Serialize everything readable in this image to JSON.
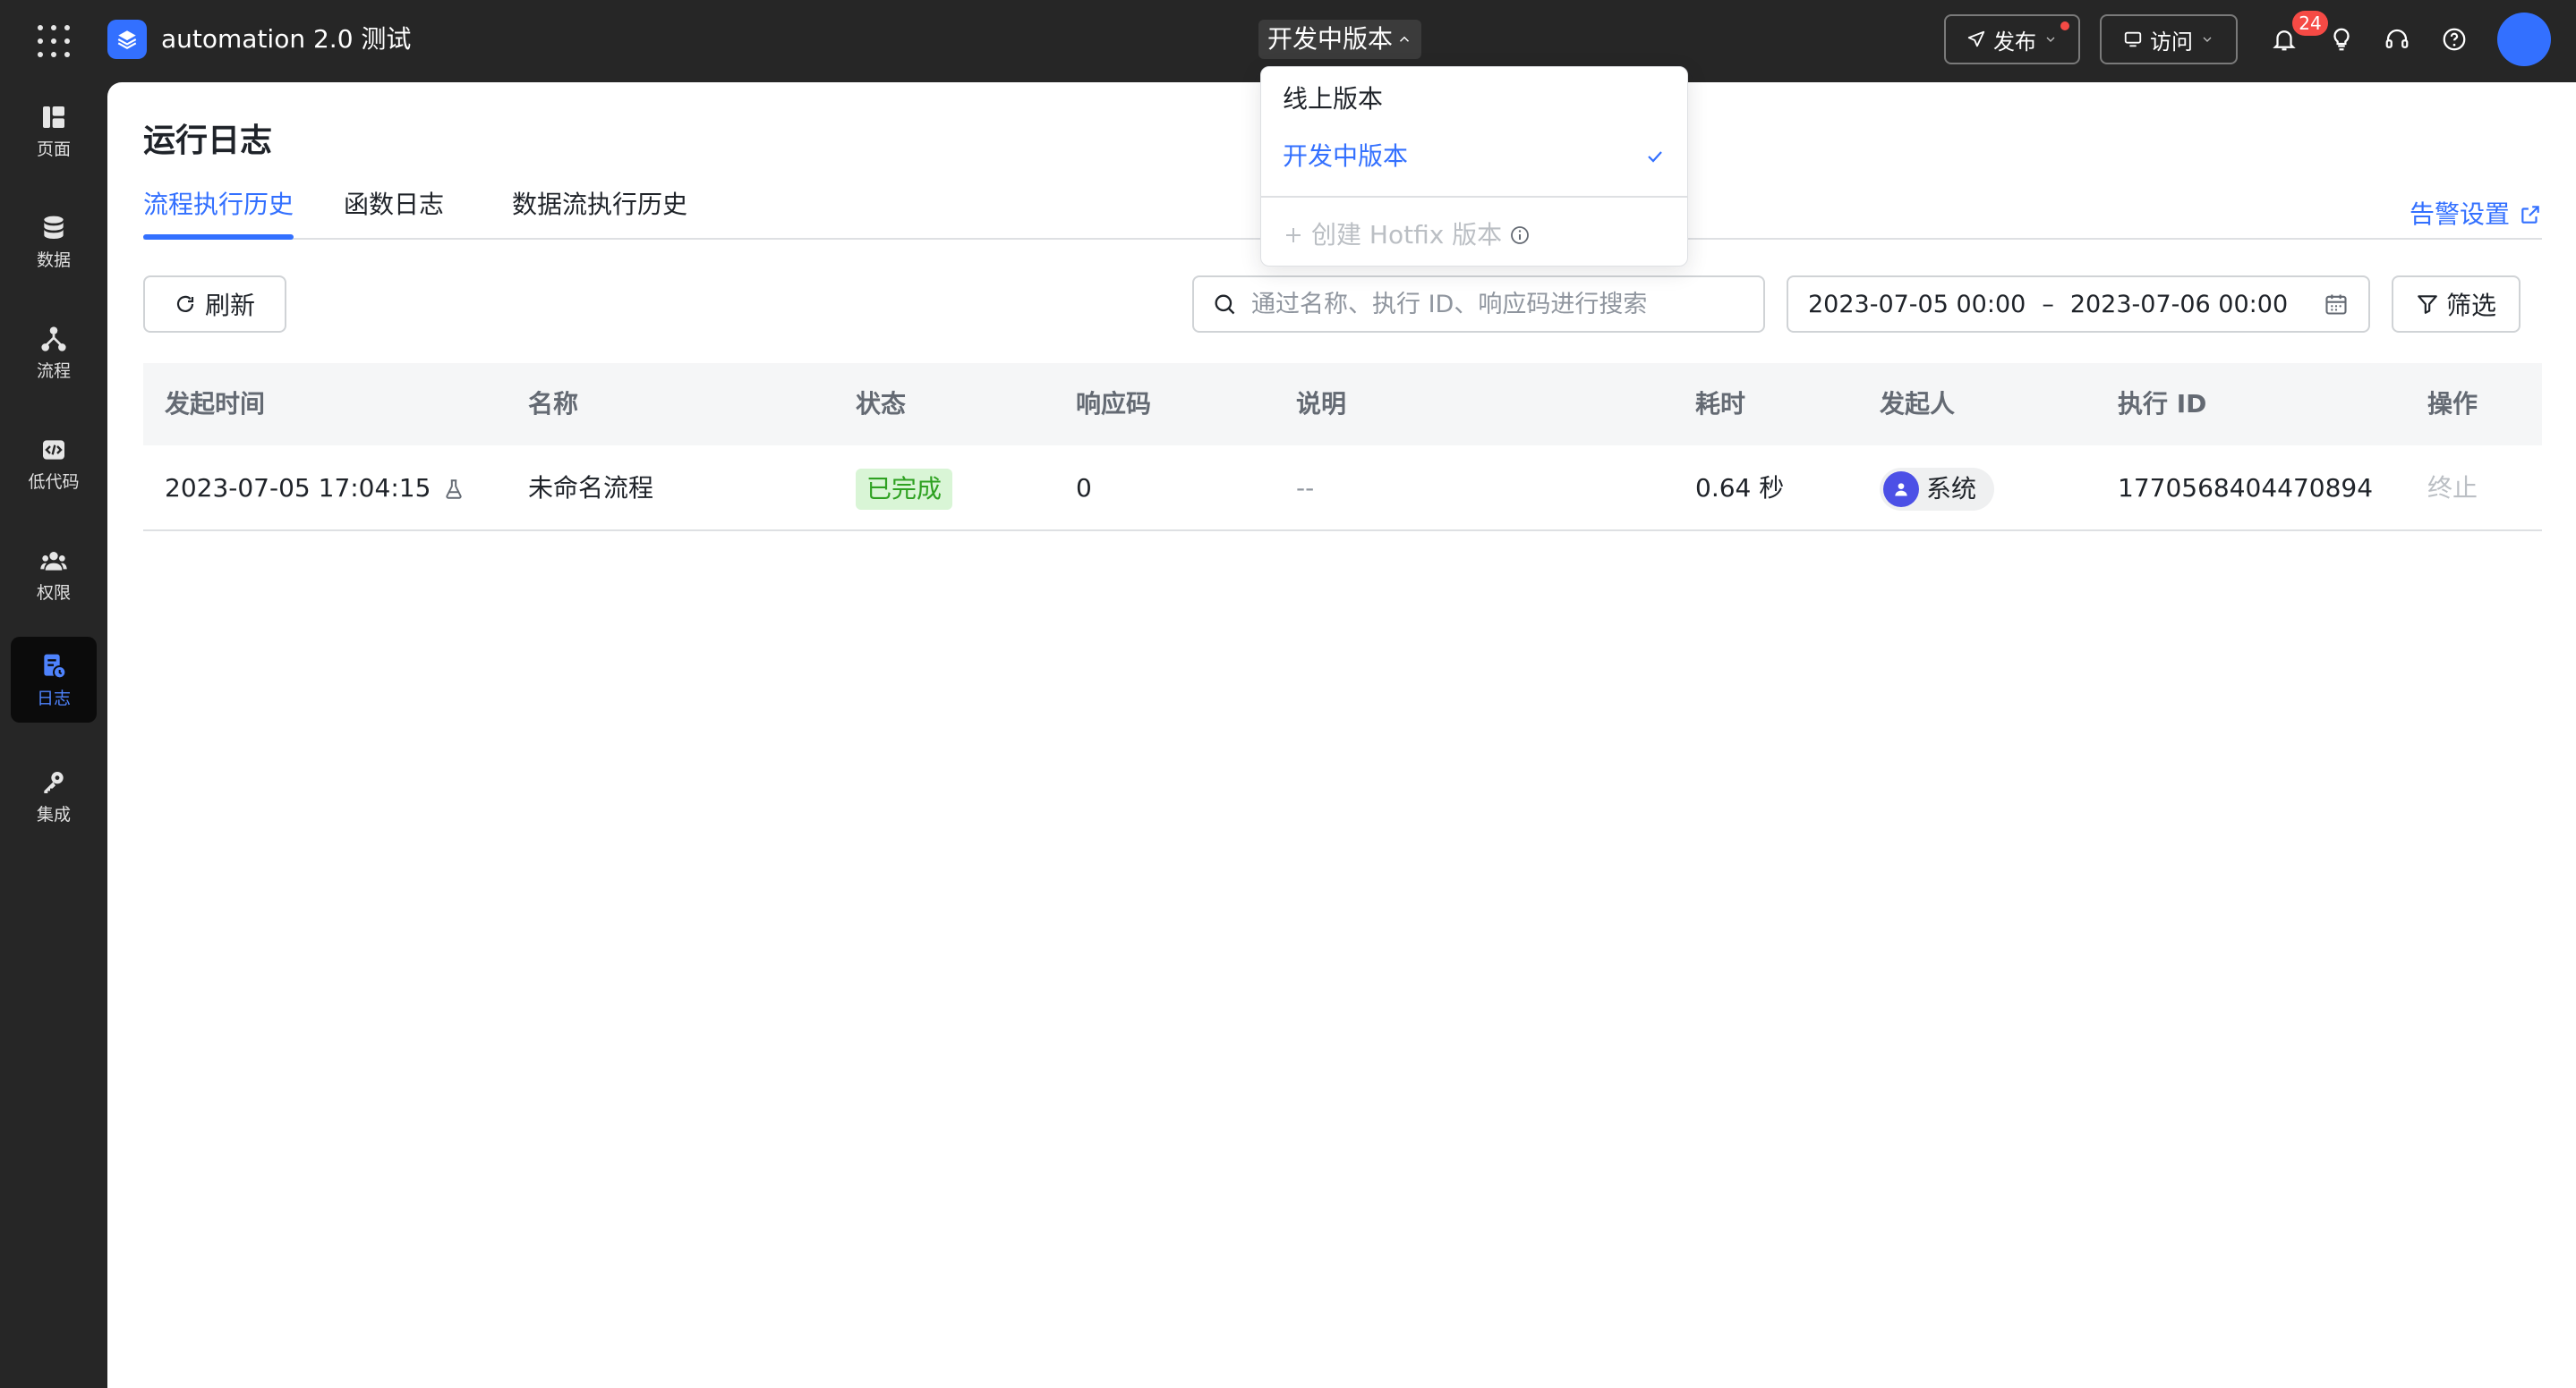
{
  "app": {
    "name": "automation 2.0 测试"
  },
  "version": {
    "current": "开发中版本",
    "options": [
      {
        "label": "线上版本",
        "selected": false
      },
      {
        "label": "开发中版本",
        "selected": true
      }
    ],
    "create_hotfix": "创建 Hotfix 版本"
  },
  "topbar": {
    "publish_label": "发布",
    "visit_label": "访问",
    "notification_count": "24"
  },
  "sidebar": {
    "items": [
      {
        "label": "页面",
        "icon": "page-icon"
      },
      {
        "label": "数据",
        "icon": "database-icon"
      },
      {
        "label": "流程",
        "icon": "flow-icon"
      },
      {
        "label": "低代码",
        "icon": "code-icon"
      },
      {
        "label": "权限",
        "icon": "users-icon"
      },
      {
        "label": "日志",
        "icon": "log-icon",
        "active": true
      },
      {
        "label": "集成",
        "icon": "key-icon"
      }
    ]
  },
  "page": {
    "title": "运行日志",
    "tabs": [
      {
        "label": "流程执行历史",
        "active": true
      },
      {
        "label": "函数日志"
      },
      {
        "label": "数据流执行历史"
      }
    ],
    "alert_settings": "告警设置"
  },
  "toolbar": {
    "refresh_label": "刷新",
    "search_placeholder": "通过名称、执行 ID、响应码进行搜索",
    "date_start": "2023-07-05 00:00",
    "date_sep": "–",
    "date_end": "2023-07-06 00:00",
    "filter_label": "筛选"
  },
  "table": {
    "columns": [
      "发起时间",
      "名称",
      "状态",
      "响应码",
      "说明",
      "耗时",
      "发起人",
      "执行 ID",
      "操作"
    ],
    "rows": [
      {
        "time": "2023-07-05 17:04:15",
        "name": "未命名流程",
        "status": "已完成",
        "code": "0",
        "desc": "--",
        "duration": "0.64 秒",
        "initiator": "系统",
        "exec_id": "1770568404470894",
        "action": "终止"
      }
    ]
  },
  "colors": {
    "primary": "#3370ff",
    "topbar_bg": "#262626",
    "status_done_bg": "#d9f5d6",
    "status_done_text": "#2ea121",
    "badge": "#f54a45"
  }
}
